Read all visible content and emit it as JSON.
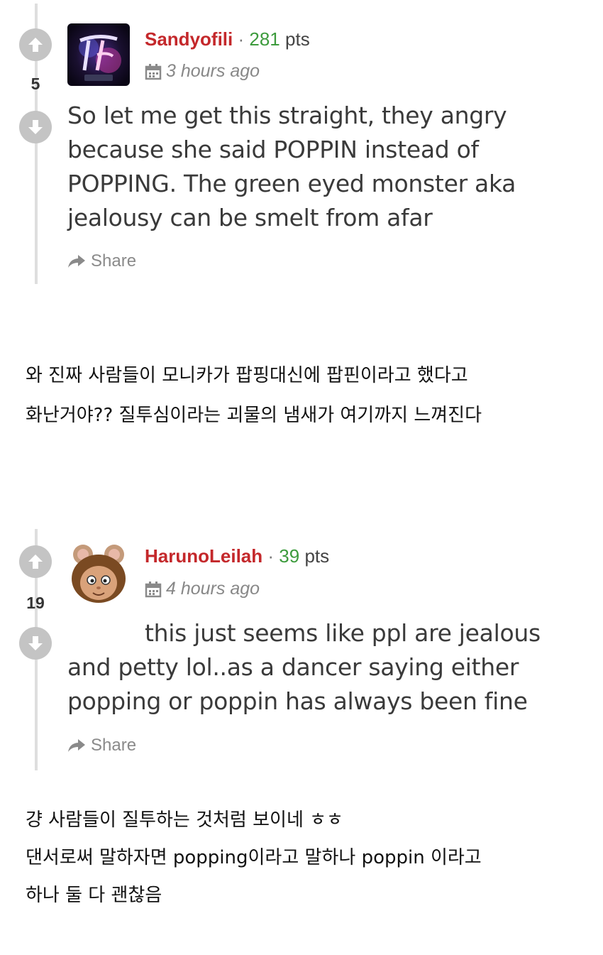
{
  "comments": [
    {
      "score": "5",
      "username": "Sandyofili",
      "separator": "·",
      "points": "281",
      "points_label": "pts",
      "time": "3 hours ago",
      "body_lines": [
        "So let me get this straight, they angry",
        "because she said POPPIN instead of",
        "POPPING. The green eyed monster aka",
        "jealousy can be smelt from afar"
      ],
      "share_label": "Share",
      "avatar_icon": "twice-logo-avatar",
      "avatar_colors": {
        "bg": "#1a1030",
        "accent1": "#6a3fc8",
        "accent2": "#d63ca8"
      }
    },
    {
      "score": "19",
      "username": "HarunoLeilah",
      "separator": "·",
      "points": "39",
      "points_label": "pts",
      "time": "4 hours ago",
      "body_lines": [
        "this just seems like ppl are jealous",
        "and petty lol..as a dancer saying either",
        "popping or poppin has always been fine"
      ],
      "share_label": "Share",
      "avatar_icon": "cartoon-mouse-avatar"
    }
  ],
  "translations": [
    {
      "lines": [
        "와 진짜 사람들이 모니카가 팝핑대신에 팝핀이라고 했다고",
        "화난거야?? 질투심이라는 괴물의 냄새가 여기까지 느껴진다"
      ]
    },
    {
      "lines": [
        "걍 사람들이 질투하는 것처럼 보이네 ㅎㅎ",
        "댄서로써 말하자면 popping이라고 말하나 poppin 이라고",
        "하나 둘 다 괜찮음"
      ]
    }
  ],
  "colors": {
    "username": "#c4282b",
    "points": "#3d9b3d",
    "vote_button": "#c4c4c4",
    "thread_line": "#dedede",
    "meta_gray": "#888888"
  }
}
